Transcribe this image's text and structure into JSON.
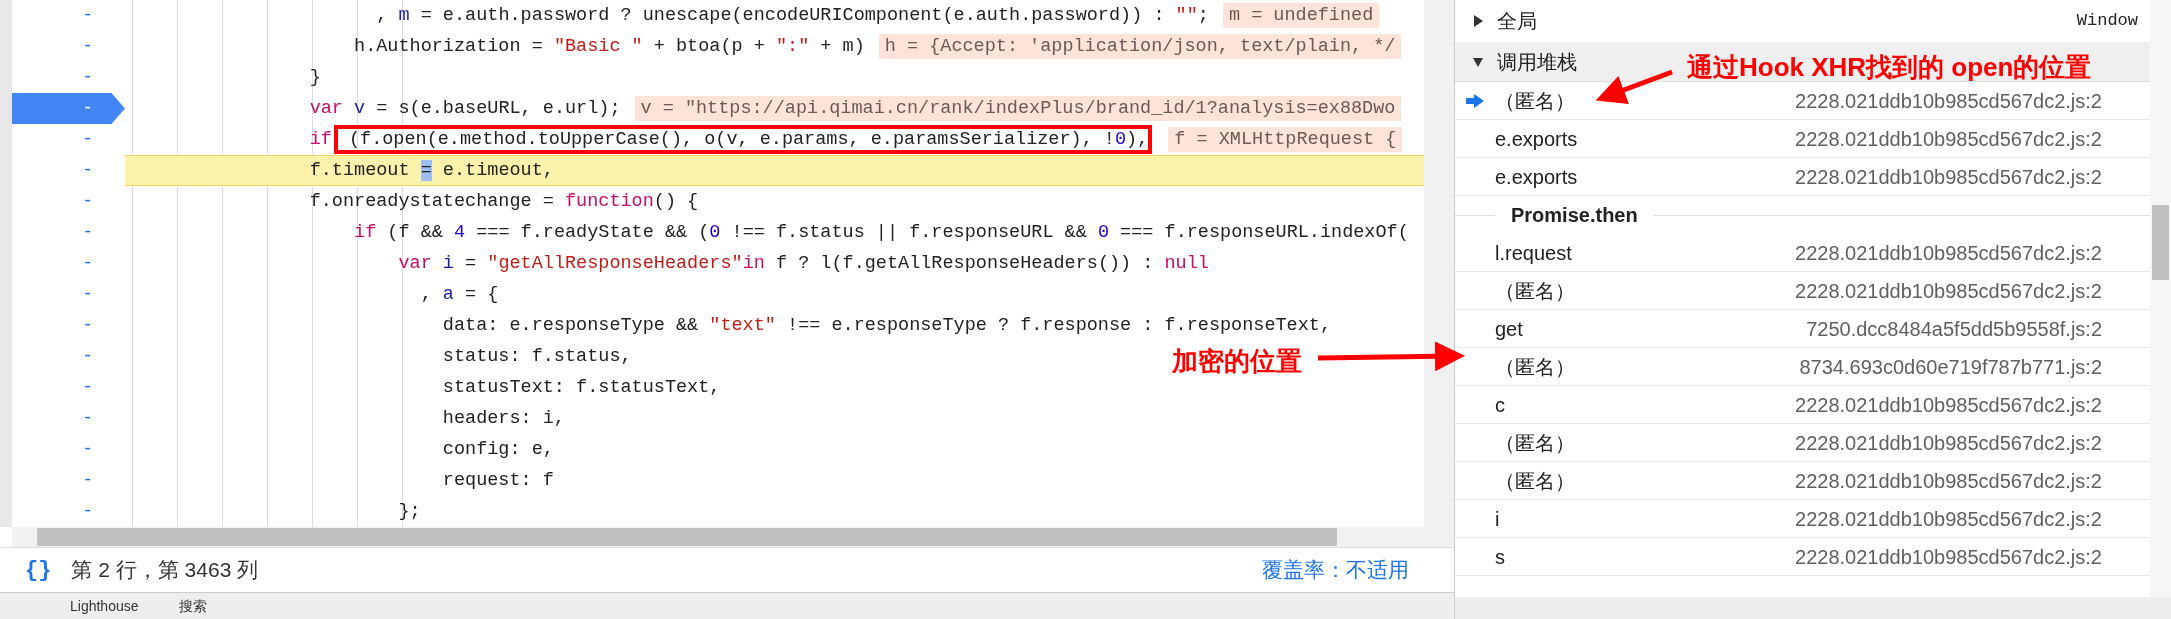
{
  "editor": {
    "lines": [
      {
        "line_number": "-",
        "breakpoint": false,
        "paused": false,
        "tokens": [
          {
            "kind": "plain",
            "text": "                      , "
          },
          {
            "kind": "def",
            "text": "m"
          },
          {
            "kind": "plain",
            "text": " = e.auth.password ? unescape(encodeURIComponent(e.auth.password)) : "
          },
          {
            "kind": "str",
            "text": "\"\""
          },
          {
            "kind": "plain",
            "text": ";"
          }
        ],
        "inline_value": "m = undefined"
      },
      {
        "line_number": "-",
        "breakpoint": false,
        "paused": false,
        "tokens": [
          {
            "kind": "plain",
            "text": "                    h.Authorization = "
          },
          {
            "kind": "str",
            "text": "\"Basic \""
          },
          {
            "kind": "plain",
            "text": " + btoa(p + "
          },
          {
            "kind": "str",
            "text": "\":\""
          },
          {
            "kind": "plain",
            "text": " + m)"
          }
        ],
        "inline_value": "h = {Accept: 'application/json, text/plain, */"
      },
      {
        "line_number": "-",
        "breakpoint": false,
        "paused": false,
        "tokens": [
          {
            "kind": "plain",
            "text": "                }"
          }
        ]
      },
      {
        "line_number": "-",
        "breakpoint": true,
        "paused": false,
        "tokens": [
          {
            "kind": "kw",
            "text": "                var "
          },
          {
            "kind": "def",
            "text": "v"
          },
          {
            "kind": "plain",
            "text": " = s(e.baseURL, e.url);"
          }
        ],
        "inline_value": "v = \"https://api.qimai.cn/rank/indexPlus/brand_id/1?analysis=ex88Dwo"
      },
      {
        "line_number": "-",
        "breakpoint": false,
        "paused": false,
        "tokens": [
          {
            "kind": "kw",
            "text": "                if"
          },
          {
            "kind": "plain",
            "text": " (f.open(e.method.toUpperCase(), o(v, e.params, e.paramsSerializer), !",
            "boxed": true
          },
          {
            "kind": "num",
            "text": "0",
            "boxed": true
          },
          {
            "kind": "plain",
            "text": "),",
            "boxed": true
          }
        ],
        "inline_value": "f = XMLHttpRequest {"
      },
      {
        "line_number": "-",
        "breakpoint": false,
        "paused": true,
        "tokens": [
          {
            "kind": "plain",
            "text": "                f.timeout "
          },
          {
            "kind": "cursor",
            "text": "="
          },
          {
            "kind": "plain",
            "text": " e.timeout,"
          }
        ]
      },
      {
        "line_number": "-",
        "breakpoint": false,
        "paused": false,
        "tokens": [
          {
            "kind": "plain",
            "text": "                f.onreadystatechange = "
          },
          {
            "kind": "kw",
            "text": "function"
          },
          {
            "kind": "plain",
            "text": "() {"
          }
        ]
      },
      {
        "line_number": "-",
        "breakpoint": false,
        "paused": false,
        "tokens": [
          {
            "kind": "kw",
            "text": "                    if"
          },
          {
            "kind": "plain",
            "text": " (f && "
          },
          {
            "kind": "num",
            "text": "4"
          },
          {
            "kind": "plain",
            "text": " === f.readyState && ("
          },
          {
            "kind": "num",
            "text": "0"
          },
          {
            "kind": "plain",
            "text": " !== f.status || f.responseURL && "
          },
          {
            "kind": "num",
            "text": "0"
          },
          {
            "kind": "plain",
            "text": " === f.responseURL.indexOf("
          }
        ]
      },
      {
        "line_number": "-",
        "breakpoint": false,
        "paused": false,
        "tokens": [
          {
            "kind": "kw",
            "text": "                        var "
          },
          {
            "kind": "def",
            "text": "i"
          },
          {
            "kind": "plain",
            "text": " = "
          },
          {
            "kind": "str",
            "text": "\"getAllResponseHeaders\""
          },
          {
            "kind": "kw",
            "text": "in"
          },
          {
            "kind": "plain",
            "text": " f ? l(f.getAllResponseHeaders()) : "
          },
          {
            "kind": "kw",
            "text": "null"
          }
        ]
      },
      {
        "line_number": "-",
        "breakpoint": false,
        "paused": false,
        "tokens": [
          {
            "kind": "plain",
            "text": "                          , "
          },
          {
            "kind": "def",
            "text": "a"
          },
          {
            "kind": "plain",
            "text": " = {"
          }
        ]
      },
      {
        "line_number": "-",
        "breakpoint": false,
        "paused": false,
        "tokens": [
          {
            "kind": "plain",
            "text": "                            data: e.responseType && "
          },
          {
            "kind": "str",
            "text": "\"text\""
          },
          {
            "kind": "plain",
            "text": " !== e.responseType ? f.response : f.responseText,"
          }
        ]
      },
      {
        "line_number": "-",
        "breakpoint": false,
        "paused": false,
        "tokens": [
          {
            "kind": "plain",
            "text": "                            status: f.status,"
          }
        ]
      },
      {
        "line_number": "-",
        "breakpoint": false,
        "paused": false,
        "tokens": [
          {
            "kind": "plain",
            "text": "                            statusText: f.statusText,"
          }
        ]
      },
      {
        "line_number": "-",
        "breakpoint": false,
        "paused": false,
        "tokens": [
          {
            "kind": "plain",
            "text": "                            headers: i,"
          }
        ]
      },
      {
        "line_number": "-",
        "breakpoint": false,
        "paused": false,
        "tokens": [
          {
            "kind": "plain",
            "text": "                            config: e,"
          }
        ]
      },
      {
        "line_number": "-",
        "breakpoint": false,
        "paused": false,
        "tokens": [
          {
            "kind": "plain",
            "text": "                            request: f"
          }
        ]
      },
      {
        "line_number": "-",
        "breakpoint": false,
        "paused": false,
        "tokens": [
          {
            "kind": "plain",
            "text": "                        };"
          }
        ]
      }
    ]
  },
  "status_bar": {
    "format_button": "{}",
    "position": "第 2 行，第 3463 列",
    "coverage": "覆盖率：不适用"
  },
  "drawer_tabs": [
    "Lighthouse",
    "搜索"
  ],
  "scope": {
    "label": "全局",
    "value": "Window",
    "expanded": false
  },
  "call_stack": {
    "title": "调用堆栈",
    "expanded": true,
    "frames": [
      {
        "kind": "frame",
        "name": "（匿名）",
        "location": "2228.021ddb10b985cd567dc2.js:2",
        "current": true
      },
      {
        "kind": "frame",
        "name": "e.exports",
        "location": "2228.021ddb10b985cd567dc2.js:2",
        "current": false
      },
      {
        "kind": "frame",
        "name": "e.exports",
        "location": "2228.021ddb10b985cd567dc2.js:2",
        "current": false
      },
      {
        "kind": "async",
        "name": "Promise.then"
      },
      {
        "kind": "frame",
        "name": "l.request",
        "location": "2228.021ddb10b985cd567dc2.js:2",
        "current": false
      },
      {
        "kind": "frame",
        "name": "（匿名）",
        "location": "2228.021ddb10b985cd567dc2.js:2",
        "current": false
      },
      {
        "kind": "frame",
        "name": "get",
        "location": "7250.dcc8484a5f5dd5b9558f.js:2",
        "current": false
      },
      {
        "kind": "frame",
        "name": "（匿名）",
        "location": "8734.693c0d60e719f787b771.js:2",
        "current": false
      },
      {
        "kind": "frame",
        "name": "c",
        "location": "2228.021ddb10b985cd567dc2.js:2",
        "current": false
      },
      {
        "kind": "frame",
        "name": "（匿名）",
        "location": "2228.021ddb10b985cd567dc2.js:2",
        "current": false
      },
      {
        "kind": "frame",
        "name": "（匿名）",
        "location": "2228.021ddb10b985cd567dc2.js:2",
        "current": false
      },
      {
        "kind": "frame",
        "name": "i",
        "location": "2228.021ddb10b985cd567dc2.js:2",
        "current": false
      },
      {
        "kind": "frame",
        "name": "s",
        "location": "2228.021ddb10b985cd567dc2.js:2",
        "current": false
      }
    ]
  },
  "annotations": [
    {
      "text": "通过Hook XHR找到的 open的位置"
    },
    {
      "text": "加密的位置"
    }
  ]
}
